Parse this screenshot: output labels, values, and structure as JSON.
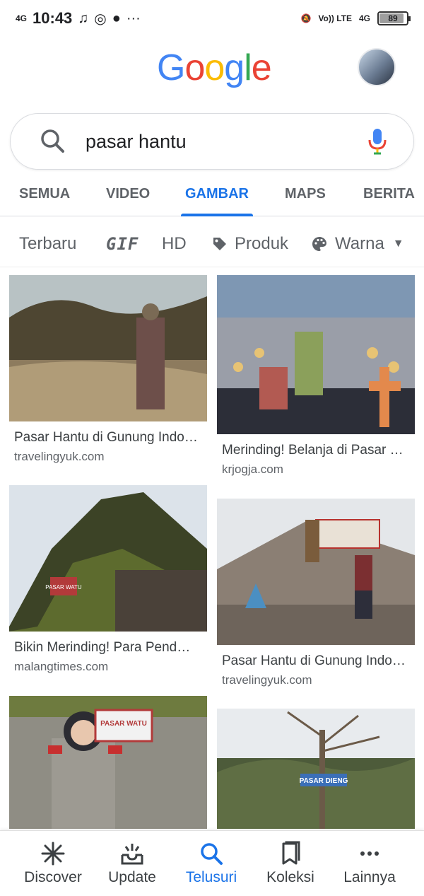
{
  "status_bar": {
    "network": "4G",
    "time": "10:43",
    "more": "···",
    "volte": "Vo)) LTE",
    "signal2": "4G",
    "battery": "89",
    "battery_level_percent": 89
  },
  "header": {
    "logo": [
      "G",
      "o",
      "o",
      "g",
      "l",
      "e"
    ],
    "avatar": "user-avatar"
  },
  "search": {
    "query": "pasar hantu"
  },
  "tabs": [
    {
      "label": "SEMUA"
    },
    {
      "label": "VIDEO"
    },
    {
      "label": "GAMBAR"
    },
    {
      "label": "MAPS"
    },
    {
      "label": "BERITA"
    }
  ],
  "active_tab": "GAMBAR",
  "filters": [
    {
      "label": "Terbaru"
    },
    {
      "label": "GIF"
    },
    {
      "label": "HD"
    },
    {
      "label": "Produk",
      "icon": "tag-icon"
    },
    {
      "label": "Warna",
      "icon": "palette-icon"
    }
  ],
  "results": [
    {
      "title": "Pasar Hantu di Gunung Indo…",
      "source": "travelingyuk.com"
    },
    {
      "title": "Merinding! Belanja di Pasar …",
      "source": "krjogja.com"
    },
    {
      "title": "Bikin Merinding! Para Pend…",
      "source": "malangtimes.com"
    },
    {
      "title": "Pasar Hantu di Gunung Indo…",
      "source": "travelingyuk.com"
    },
    {
      "title": "",
      "source": ""
    },
    {
      "title": "",
      "source": ""
    }
  ],
  "image_signs": {
    "pasar_watu": "PASAR WATU",
    "pasar_dieng": "PASAR DIENG"
  },
  "bottom_nav": [
    {
      "label": "Discover",
      "icon": "asterisk-icon"
    },
    {
      "label": "Update",
      "icon": "inbox-update-icon"
    },
    {
      "label": "Telusuri",
      "icon": "search-icon"
    },
    {
      "label": "Koleksi",
      "icon": "collections-icon"
    },
    {
      "label": "Lainnya",
      "icon": "more-icon"
    }
  ],
  "colors": {
    "accent": "#1a73e8",
    "text": "#202124",
    "secondary": "#5f6368"
  }
}
